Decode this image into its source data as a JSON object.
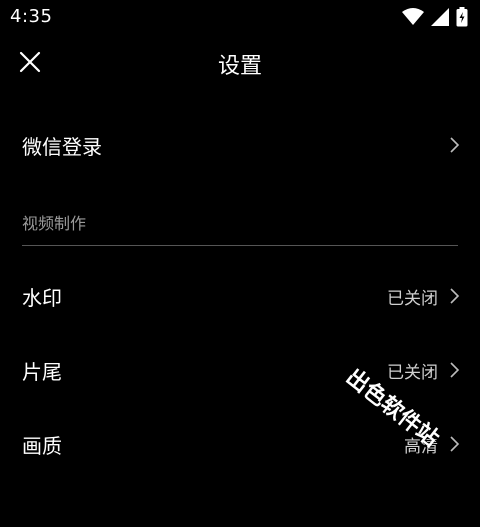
{
  "status_bar": {
    "time": "4:35"
  },
  "header": {
    "title": "设置"
  },
  "rows": {
    "wechat_login": {
      "label": "微信登录"
    },
    "watermark_setting": {
      "label": "水印",
      "value": "已关闭"
    },
    "ending_setting": {
      "label": "片尾",
      "value": "已关闭"
    },
    "quality_setting": {
      "label": "画质",
      "value": "高清"
    }
  },
  "section": {
    "video_production": "视频制作"
  },
  "overlay": {
    "watermark_text": "出色软件站"
  },
  "colors": {
    "background": "#000000",
    "text": "#ffffff",
    "secondary": "#9a9a9a",
    "divider": "#555555"
  },
  "icons": [
    "close-icon",
    "wifi-icon",
    "signal-icon",
    "battery-icon",
    "chevron-right-icon"
  ]
}
